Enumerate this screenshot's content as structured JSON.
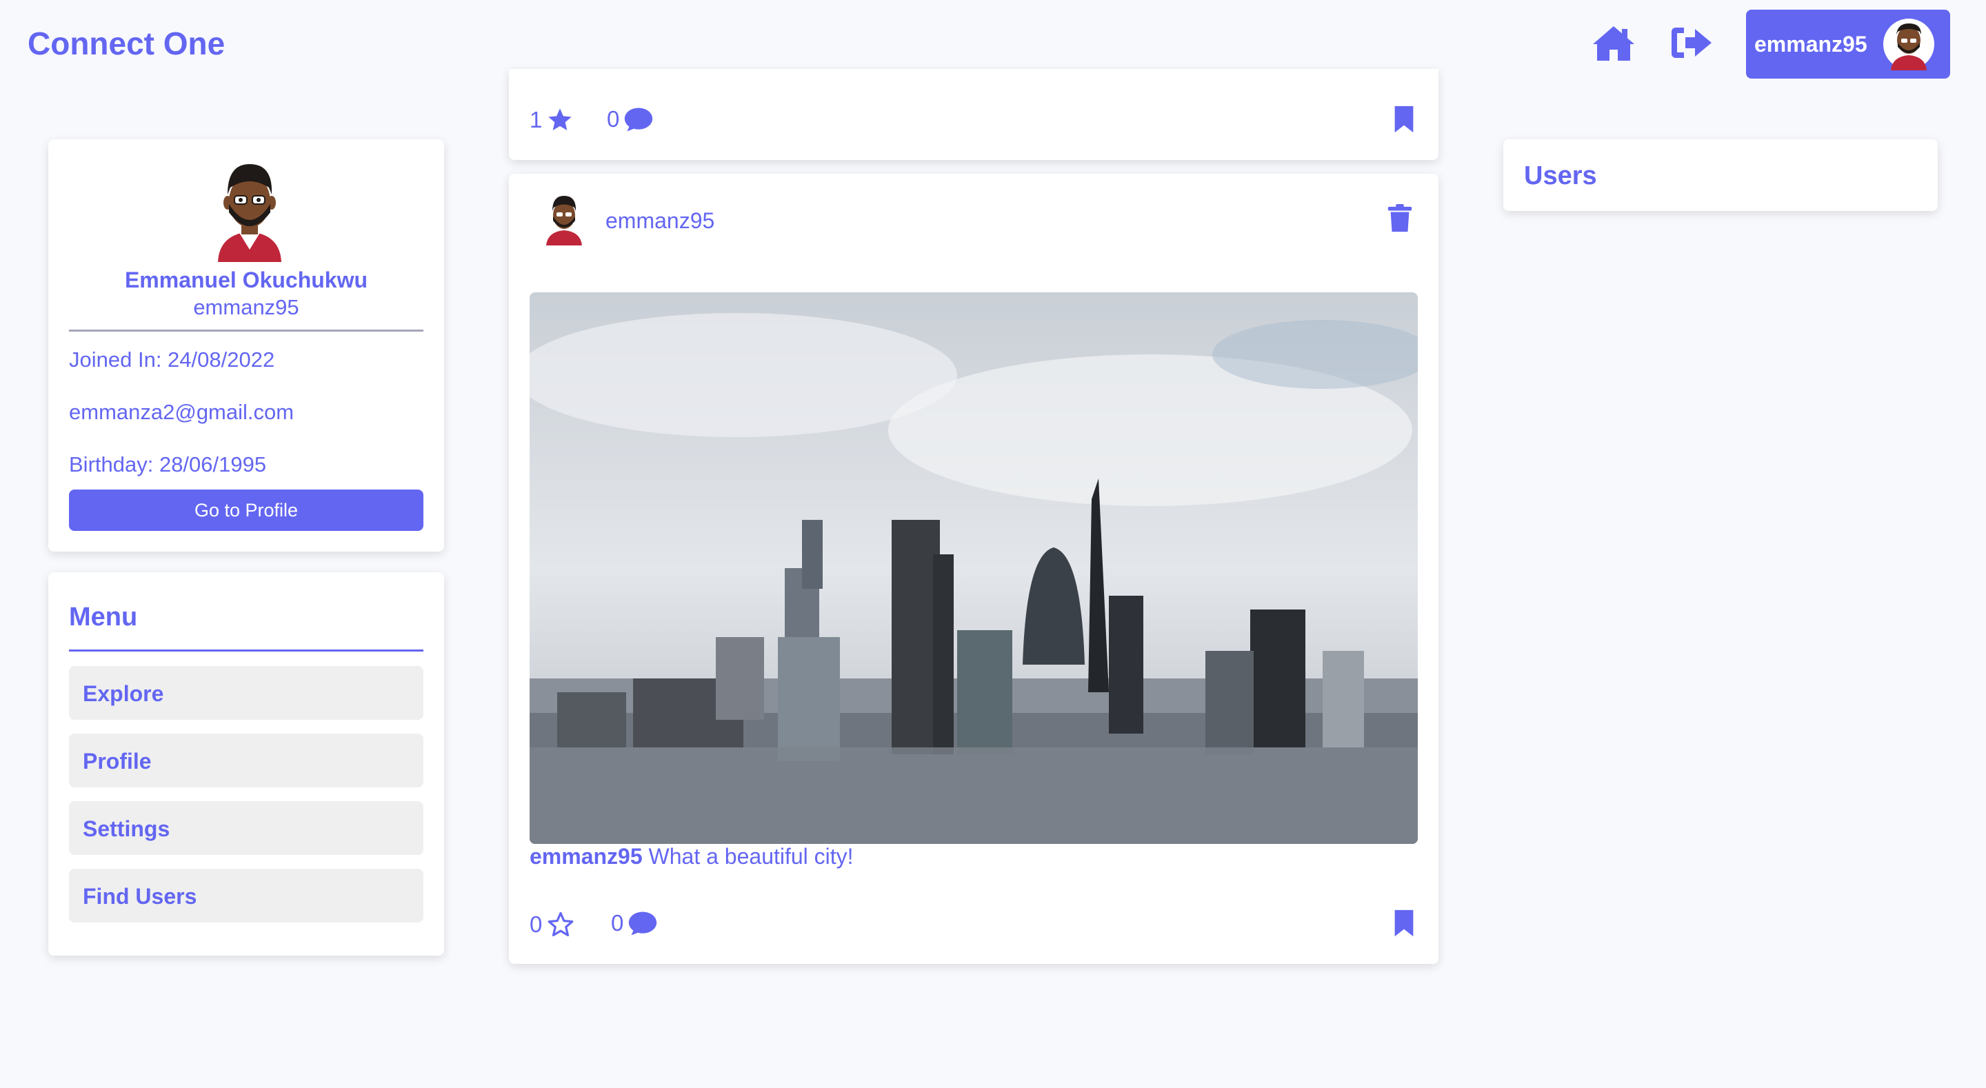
{
  "app": {
    "brand": "Connect One",
    "accent": "#6366f1"
  },
  "header": {
    "home_icon": "home-icon",
    "logout_icon": "logout-icon",
    "user_chip_name": "emmanz95"
  },
  "profile": {
    "fullname": "Emmanuel Okuchukwu",
    "username": "emmanz95",
    "joined": "Joined In: 24/08/2022",
    "email": "emmanza2@gmail.com",
    "birthday": "Birthday: 28/06/1995",
    "button": "Go to Profile"
  },
  "menu": {
    "title": "Menu",
    "items": [
      {
        "label": "Explore"
      },
      {
        "label": "Profile"
      },
      {
        "label": "Settings"
      },
      {
        "label": "Find Users"
      }
    ]
  },
  "feed": {
    "posts": [
      {
        "stars": "1",
        "comments": "0",
        "starred": true
      },
      {
        "author": "emmanz95",
        "caption_user": "emmanz95",
        "caption_text": " What a beautiful city!",
        "stars": "0",
        "comments": "0",
        "starred": false
      }
    ]
  },
  "users_panel": {
    "title": "Users"
  }
}
